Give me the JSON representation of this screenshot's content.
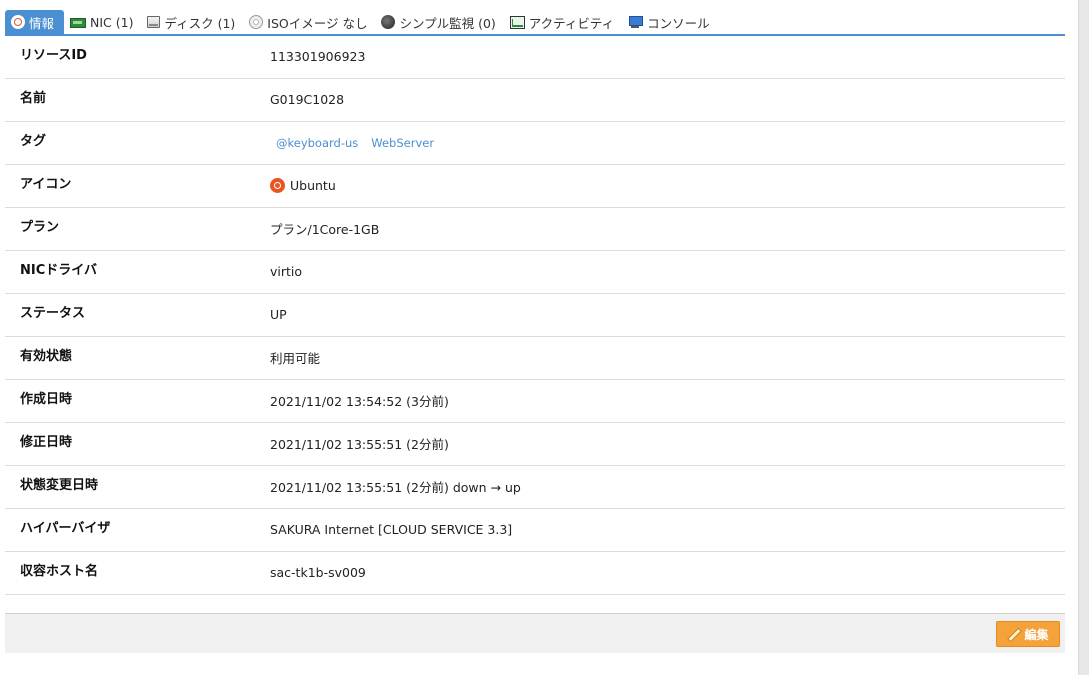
{
  "tabs": [
    {
      "label": "情報",
      "icon": "ubuntu-icon"
    },
    {
      "label": "NIC (1)",
      "icon": "nic-icon"
    },
    {
      "label": "ディスク (1)",
      "icon": "disk-icon"
    },
    {
      "label": "ISOイメージ なし",
      "icon": "cd-icon"
    },
    {
      "label": "シンプル監視 (0)",
      "icon": "monitor-icon"
    },
    {
      "label": "アクティビティ",
      "icon": "activity-icon"
    },
    {
      "label": "コンソール",
      "icon": "console-icon"
    }
  ],
  "rows": {
    "resource_id": {
      "label": "リソースID",
      "value": "113301906923"
    },
    "name": {
      "label": "名前",
      "value": "G019C1028"
    },
    "tags": {
      "label": "タグ",
      "values": [
        "@keyboard-us",
        "WebServer"
      ]
    },
    "icon": {
      "label": "アイコン",
      "value": "Ubuntu"
    },
    "plan": {
      "label": "プラン",
      "value": "プラン/1Core-1GB"
    },
    "nic_driver": {
      "label": "NICドライバ",
      "value": "virtio"
    },
    "status": {
      "label": "ステータス",
      "value": "UP"
    },
    "availability": {
      "label": "有効状態",
      "value": "利用可能"
    },
    "created": {
      "label": "作成日時",
      "value": "2021/11/02 13:54:52 (3分前)"
    },
    "modified": {
      "label": "修正日時",
      "value": "2021/11/02 13:55:51 (2分前)"
    },
    "state_changed": {
      "label": "状態変更日時",
      "value": "2021/11/02 13:55:51 (2分前) down → up"
    },
    "hypervisor": {
      "label": "ハイパーバイザ",
      "value": "SAKURA Internet [CLOUD SERVICE 3.3]"
    },
    "host": {
      "label": "収容ホスト名",
      "value": "sac-tk1b-sv009"
    }
  },
  "footer": {
    "edit_label": "編集"
  },
  "colors": {
    "accent": "#4a8fd1",
    "edit_button": "#f6a23a",
    "ubuntu": "#e95420"
  }
}
